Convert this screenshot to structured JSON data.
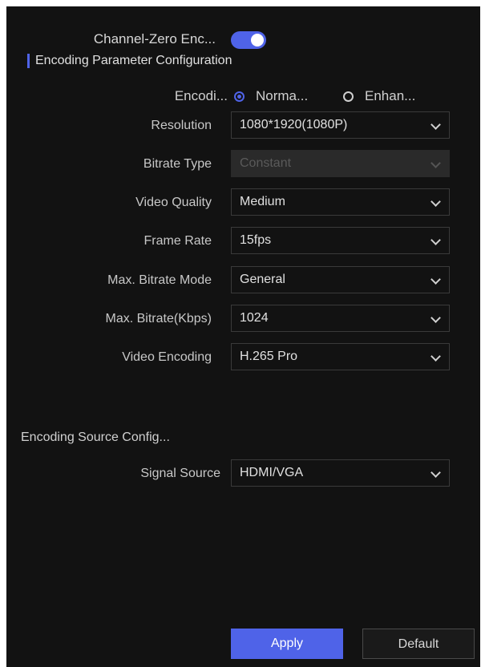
{
  "channel_zero": {
    "label": "Channel-Zero Enc...",
    "enabled": true
  },
  "section_title": "Encoding Parameter Configuration",
  "encoding_mode": {
    "label": "Encodi...",
    "options": [
      "Norma...",
      "Enhan..."
    ],
    "selected": "Norma..."
  },
  "fields": {
    "resolution": {
      "label": "Resolution",
      "value": "1080*1920(1080P)"
    },
    "bitrate_type": {
      "label": "Bitrate Type",
      "value": "Constant",
      "disabled": true
    },
    "video_quality": {
      "label": "Video Quality",
      "value": "Medium"
    },
    "frame_rate": {
      "label": "Frame Rate",
      "value": "15fps"
    },
    "max_bitrate_mode": {
      "label": "Max. Bitrate Mode",
      "value": "General"
    },
    "max_bitrate": {
      "label": "Max. Bitrate(Kbps)",
      "value": "1024"
    },
    "video_encoding": {
      "label": "Video Encoding",
      "value": "H.265 Pro"
    }
  },
  "source_section_title": "Encoding Source Config...",
  "signal_source": {
    "label": "Signal Source",
    "value": "HDMI/VGA"
  },
  "buttons": {
    "apply": "Apply",
    "default": "Default"
  },
  "colors": {
    "accent": "#4f63e8",
    "panel_bg": "#121212",
    "text": "#d0d0d0"
  }
}
